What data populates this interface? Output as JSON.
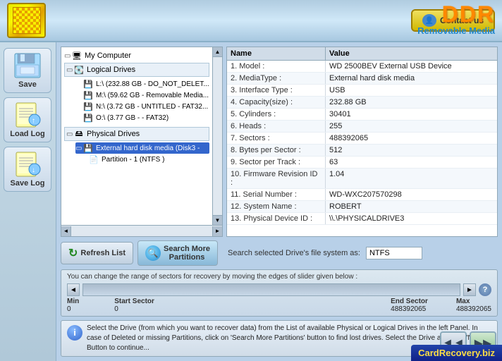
{
  "header": {
    "contact_label": "Contact us",
    "ddr_title": "DDR",
    "ddr_subtitle": "Removable Media"
  },
  "sidebar": {
    "save_label": "Save",
    "load_log_label": "Load Log",
    "save_log_label": "Save Log"
  },
  "tree": {
    "root": "My Computer",
    "logical_group": "Logical Drives",
    "drives": [
      "L:\\ (232.88 GB - DO_NOT_DELET...",
      "M:\\ (59.62 GB - Removable Media...",
      "N:\\ (3.72 GB - UNTITLED - FAT32...",
      "O:\\ (3.77 GB - - FAT32)"
    ],
    "physical_group": "Physical Drives",
    "selected_disk": "External hard disk media (Disk3 -",
    "partition": "Partition - 1 (NTFS )"
  },
  "details": {
    "col_name": "Name",
    "col_value": "Value",
    "rows": [
      {
        "name": "1. Model :",
        "value": "WD 2500BEV External USB Device"
      },
      {
        "name": "2. MediaType :",
        "value": "External hard disk media"
      },
      {
        "name": "3. Interface Type :",
        "value": "USB"
      },
      {
        "name": "4. Capacity(size) :",
        "value": "232.88 GB"
      },
      {
        "name": "5. Cylinders :",
        "value": "30401"
      },
      {
        "name": "6. Heads :",
        "value": "255"
      },
      {
        "name": "7. Sectors :",
        "value": "488392065"
      },
      {
        "name": "8. Bytes per Sector :",
        "value": "512"
      },
      {
        "name": "9. Sector per Track :",
        "value": "63"
      },
      {
        "name": "10. Firmware Revision ID :",
        "value": "1.04"
      },
      {
        "name": "11. Serial Number :",
        "value": "WD-WXC207570298"
      },
      {
        "name": "12. System Name :",
        "value": "ROBERT"
      },
      {
        "name": "13. Physical Device ID :",
        "value": "\\\\.\\PHYSICALDRIVE3"
      }
    ]
  },
  "actions": {
    "refresh_label": "Refresh List",
    "search_label": "Search More\nPartitions",
    "filesystem_label": "Search selected Drive's file system as:",
    "filesystem_value": "NTFS"
  },
  "slider": {
    "description": "You can change the range of sectors for recovery by moving the edges of slider given below :",
    "min_label": "Min",
    "min_value": "0",
    "start_label": "Start Sector",
    "start_value": "0",
    "end_label": "End Sector",
    "end_value": "488392065",
    "max_label": "Max",
    "max_value": "488392065"
  },
  "info": {
    "text": "Select the Drive (from which you want to recover data) from the List of available Physical or Logical Drives in the left Panel. In case of Deleted or missing Partitions, click on 'Search More Partitions' button to find lost drives. Select the Drive and click 'Next' Button to continue..."
  },
  "footer": {
    "card_recovery": "CardRecovery",
    "card_recovery_suffix": ".biz"
  }
}
